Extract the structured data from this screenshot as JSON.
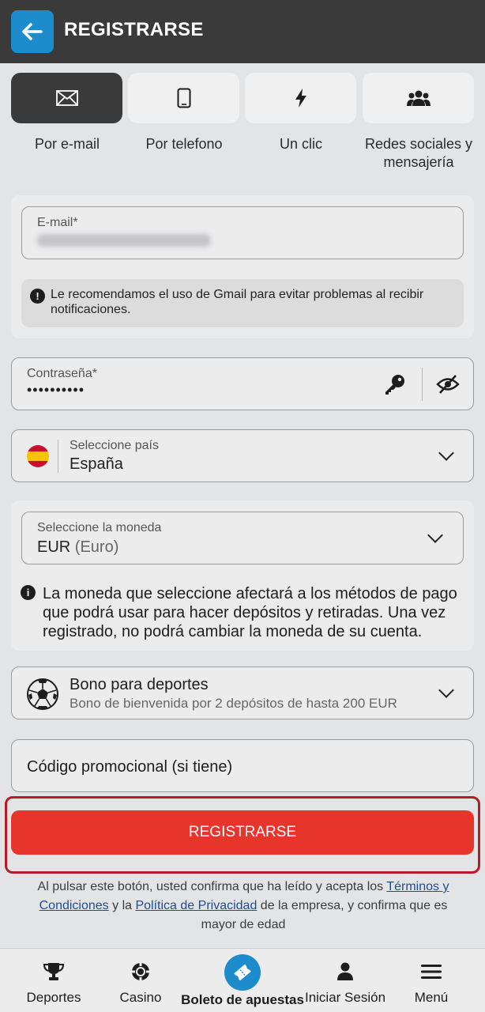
{
  "header": {
    "title": "REGISTRARSE"
  },
  "tabs": [
    {
      "label": "Por e-mail",
      "icon": "envelope-icon",
      "active": true
    },
    {
      "label": "Por telefono",
      "icon": "phone-icon",
      "active": false
    },
    {
      "label": "Un clic",
      "icon": "lightning-icon",
      "active": false
    },
    {
      "label": "Redes sociales y mensajería",
      "icon": "users-icon",
      "active": false
    }
  ],
  "email": {
    "label": "E-mail*",
    "hint": "Le recomendamos el uso de Gmail para evitar problemas al recibir notificaciones."
  },
  "password": {
    "label": "Contraseña*",
    "value": "••••••••••"
  },
  "country": {
    "label": "Seleccione país",
    "value": "España"
  },
  "currency": {
    "label": "Seleccione la moneda",
    "code": "EUR",
    "name": "(Euro)",
    "note": "La moneda que seleccione afectará a los métodos de pago que podrá usar para hacer depósitos y retiradas. Una vez registrado, no podrá cambiar la moneda de su cuenta."
  },
  "bonus": {
    "title": "Bono para deportes",
    "subtitle": "Bono de bienvenida por 2 depósitos de hasta 200 EUR"
  },
  "promo": {
    "placeholder": "Código promocional (si tiene)"
  },
  "register_button": "REGISTRARSE",
  "legal": {
    "part1": "Al pulsar este botón, usted confirma que ha leído y acepta los ",
    "terms_link": "Términos y Condiciones",
    "part2": " y la ",
    "privacy_link": "Política de Privacidad",
    "part3": " de la empresa, y confirma que es mayor de edad"
  },
  "bottom_nav": {
    "sports": "Deportes",
    "casino": "Casino",
    "betslip": "Boleto de apuestas",
    "login": "Iniciar Sesión",
    "menu": "Menú"
  },
  "colors": {
    "accent_blue": "#1d8ccc",
    "register_red": "#e8352c",
    "outline_red": "#b71c26",
    "header_dark": "#3a3a3a"
  }
}
